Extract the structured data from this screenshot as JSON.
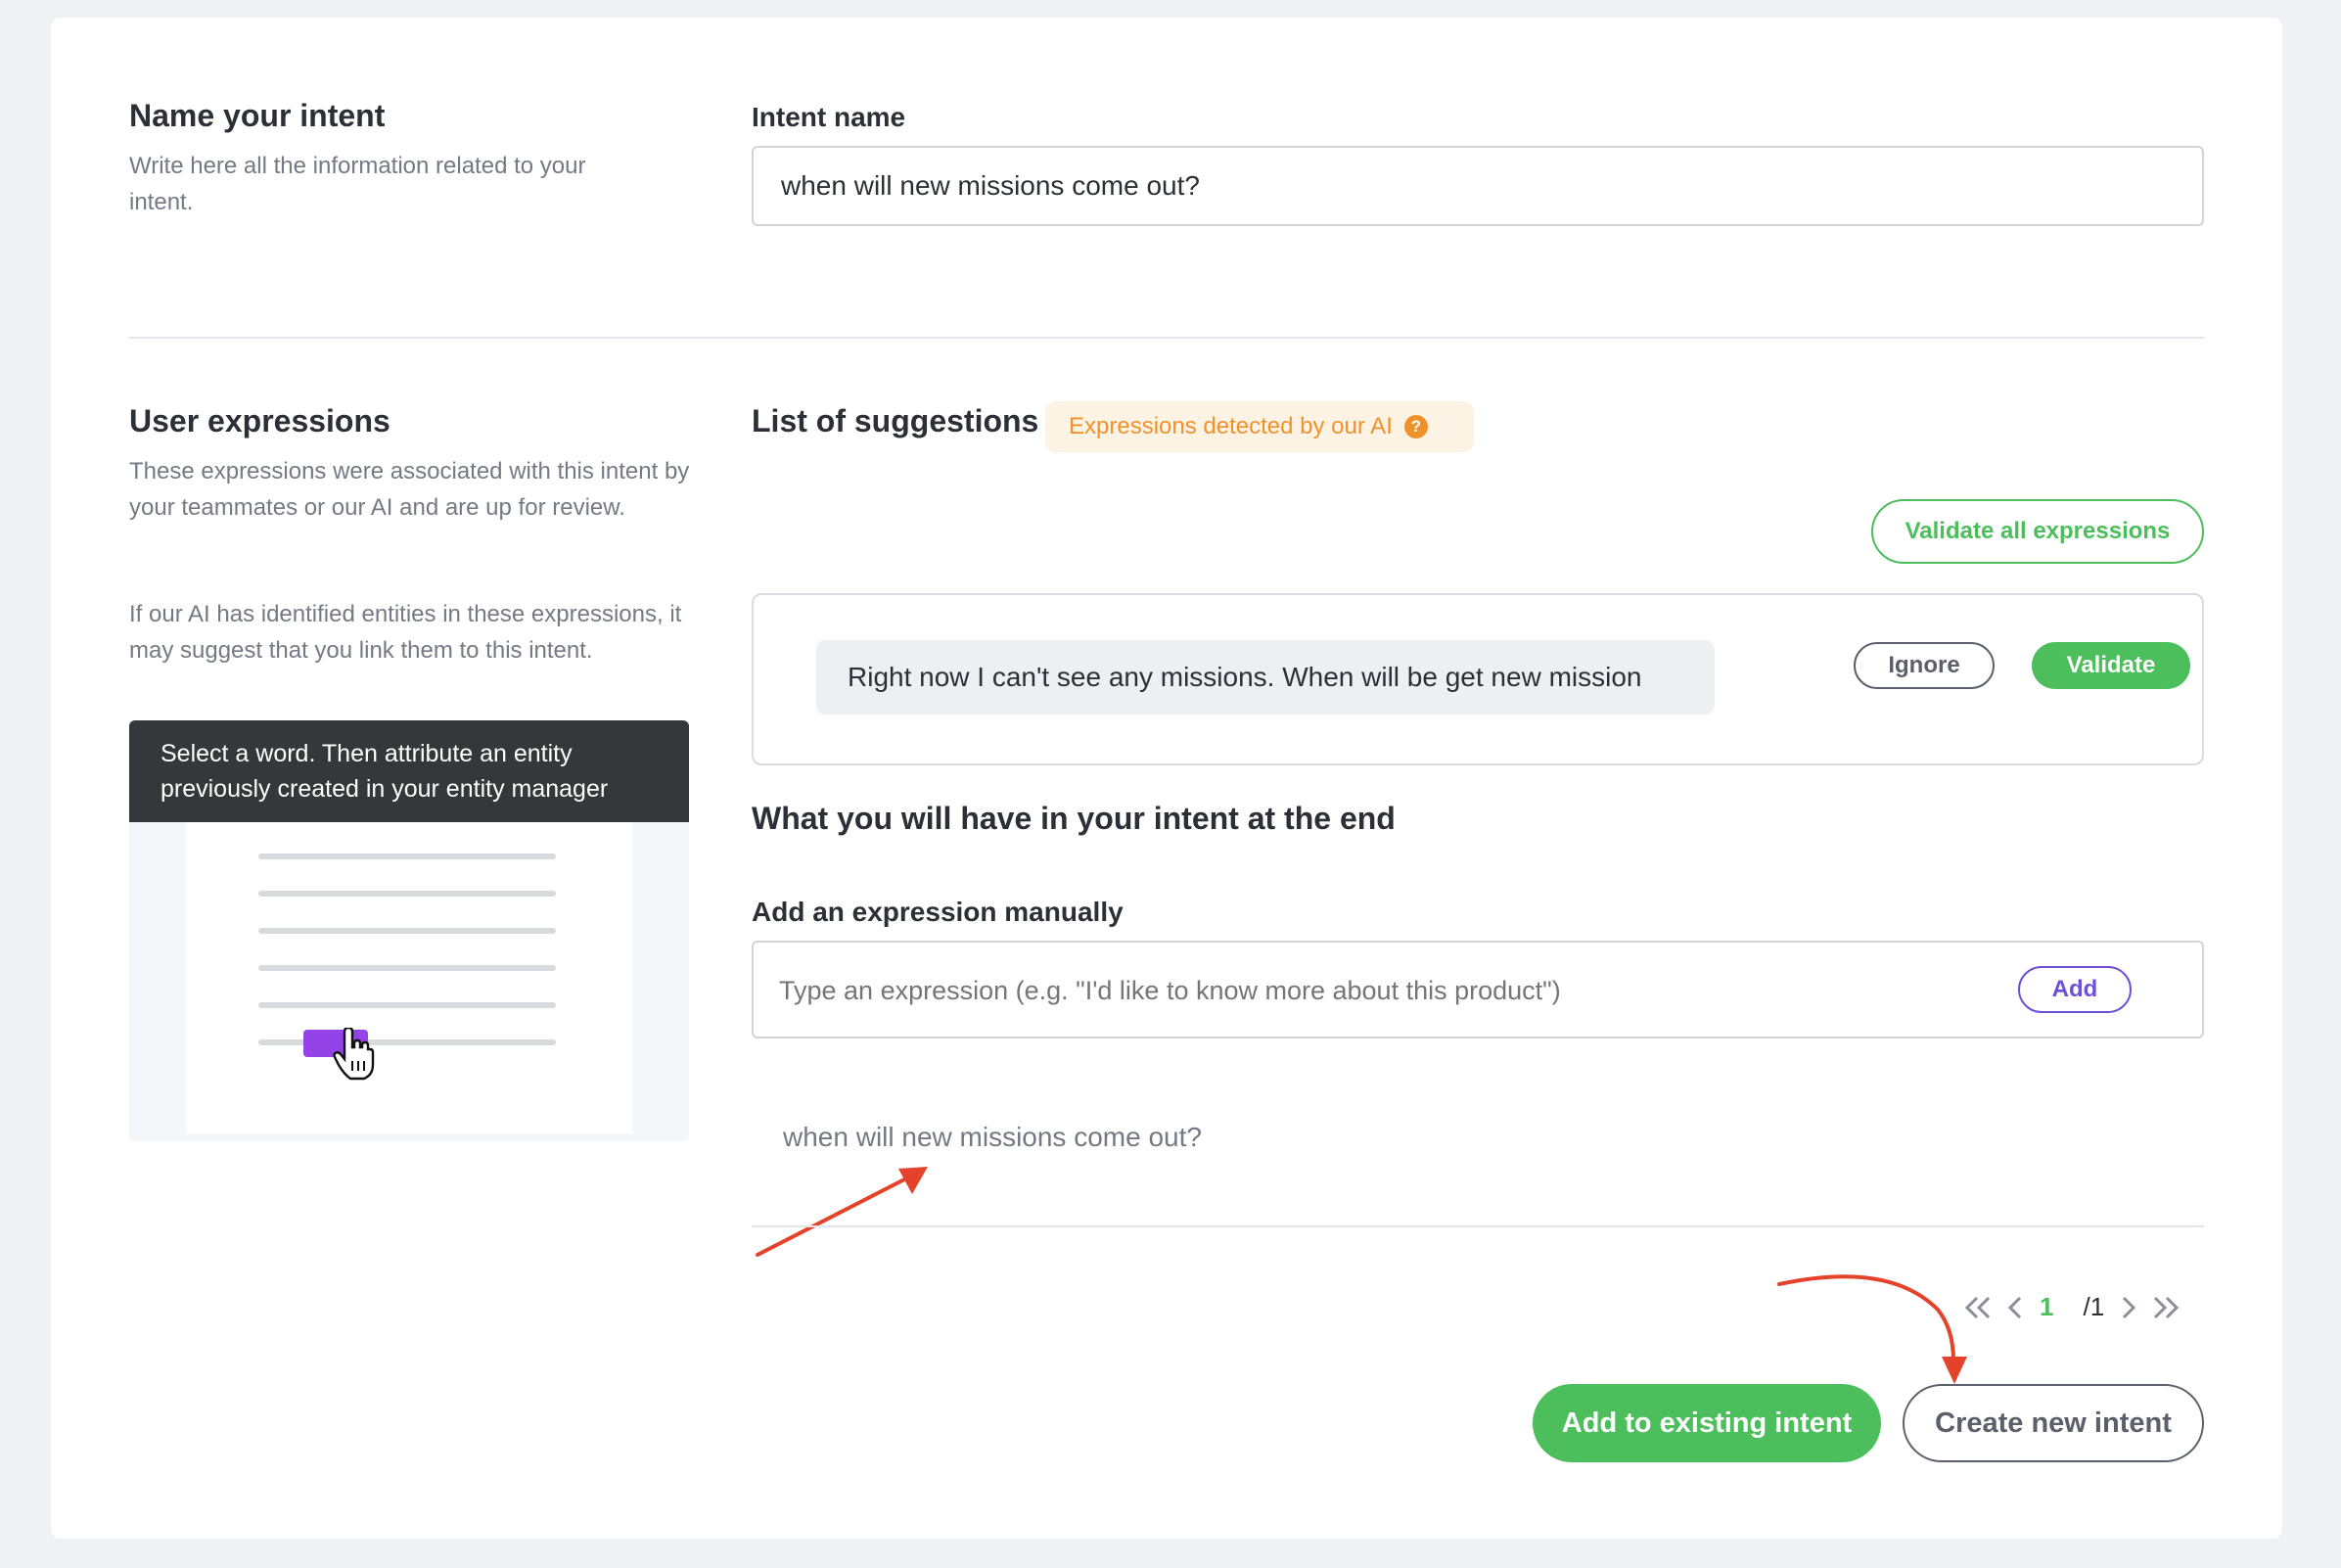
{
  "name_section": {
    "title": "Name your intent",
    "description": "Write here all the information related to your intent.",
    "field_label": "Intent name",
    "field_value": "when will new missions come out?"
  },
  "expressions_section": {
    "title": "User expressions",
    "description_1": "These expressions were associated with this intent by your teammates or our AI and are up for review.",
    "description_2": "If our AI has identified entities in these expressions, it may suggest that you link them to this intent.",
    "tooltip_text": "Select a word. Then attribute an entity previously created in your entity manager"
  },
  "suggestions": {
    "title": "List of suggestions",
    "ai_badge": "Expressions detected by our AI",
    "ai_badge_help": "?",
    "validate_all_label": "Validate all expressions",
    "items": [
      {
        "text": "Right now I can't see any missions. When will be get new mission",
        "ignore_label": "Ignore",
        "validate_label": "Validate"
      }
    ]
  },
  "result": {
    "title": "What you will have in your intent at the end",
    "add_label": "Add an expression manually",
    "add_placeholder": "Type an expression (e.g. \"I'd like to know more about this product\")",
    "add_button": "Add",
    "expressions": [
      "when will new missions come out?"
    ]
  },
  "pagination": {
    "current": "1",
    "total": "/1"
  },
  "actions": {
    "add_existing": "Add to existing intent",
    "create_new": "Create new intent"
  },
  "colors": {
    "green": "#4cbe5c",
    "purple": "#6e4fd6",
    "orange": "#f0922b",
    "annotation_red": "#e5422b"
  }
}
